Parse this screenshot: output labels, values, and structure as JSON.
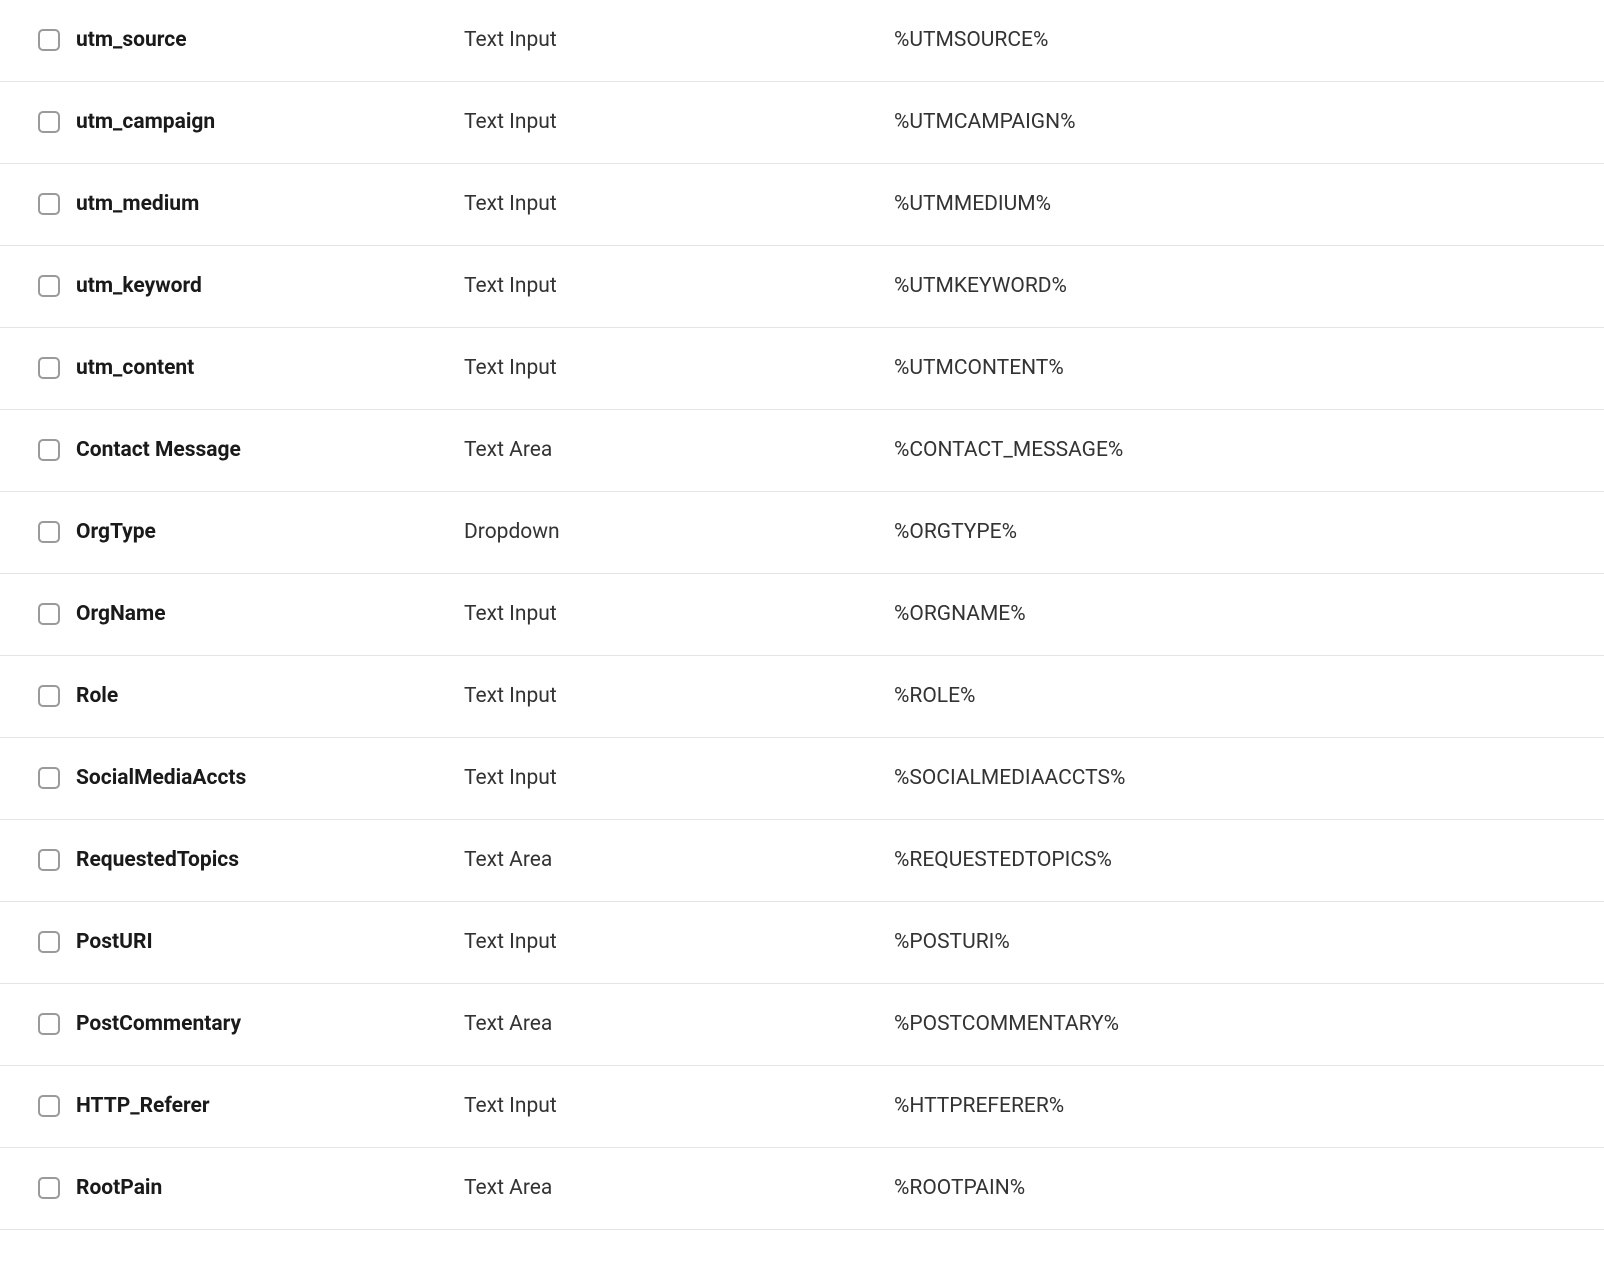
{
  "fields": [
    {
      "name": "utm_source",
      "type": "Text Input",
      "value": "%UTMSOURCE%"
    },
    {
      "name": "utm_campaign",
      "type": "Text Input",
      "value": "%UTMCAMPAIGN%"
    },
    {
      "name": "utm_medium",
      "type": "Text Input",
      "value": "%UTMMEDIUM%"
    },
    {
      "name": "utm_keyword",
      "type": "Text Input",
      "value": "%UTMKEYWORD%"
    },
    {
      "name": "utm_content",
      "type": "Text Input",
      "value": "%UTMCONTENT%"
    },
    {
      "name": "Contact Message",
      "type": "Text Area",
      "value": "%CONTACT_MESSAGE%"
    },
    {
      "name": "OrgType",
      "type": "Dropdown",
      "value": "%ORGTYPE%"
    },
    {
      "name": "OrgName",
      "type": "Text Input",
      "value": "%ORGNAME%"
    },
    {
      "name": "Role",
      "type": "Text Input",
      "value": "%ROLE%"
    },
    {
      "name": "SocialMediaAccts",
      "type": "Text Input",
      "value": "%SOCIALMEDIAACCTS%"
    },
    {
      "name": "RequestedTopics",
      "type": "Text Area",
      "value": "%REQUESTEDTOPICS%"
    },
    {
      "name": "PostURI",
      "type": "Text Input",
      "value": "%POSTURI%"
    },
    {
      "name": "PostCommentary",
      "type": "Text Area",
      "value": "%POSTCOMMENTARY%"
    },
    {
      "name": "HTTP_Referer",
      "type": "Text Input",
      "value": "%HTTPREFERER%"
    },
    {
      "name": "RootPain",
      "type": "Text Area",
      "value": "%ROOTPAIN%"
    }
  ]
}
